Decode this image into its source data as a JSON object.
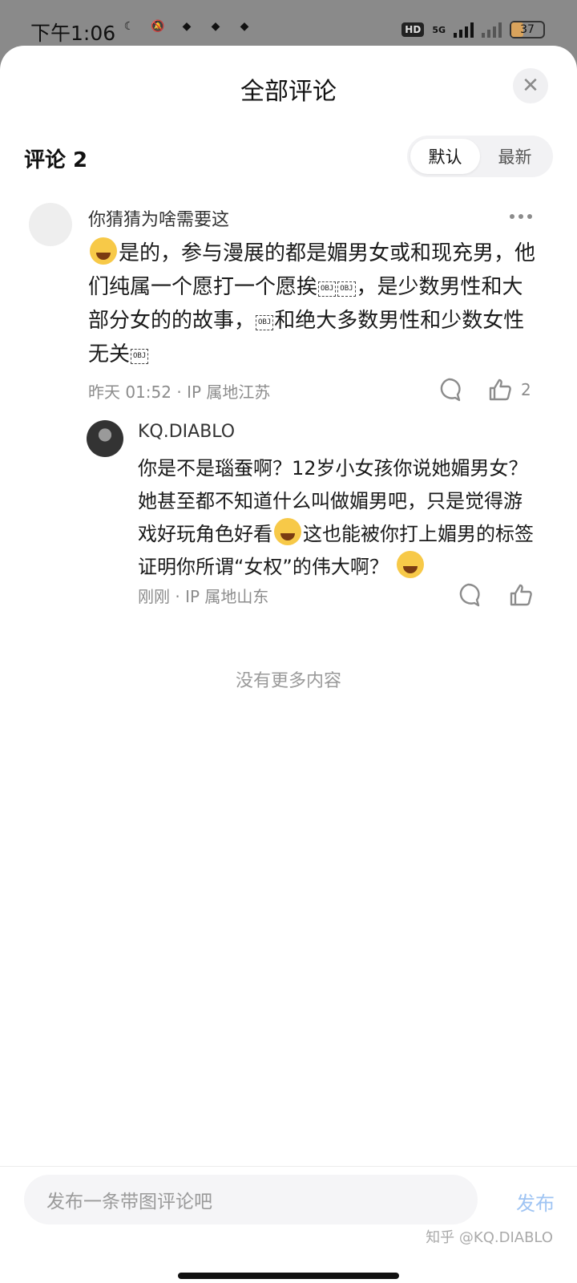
{
  "status_bar": {
    "time": "下午1:06",
    "hd": "HD",
    "net": "5G",
    "battery": "37"
  },
  "sheet": {
    "title": "全部评论",
    "close_icon": "✕",
    "count_label": "评论 2",
    "sort_default": "默认",
    "sort_latest": "最新"
  },
  "comments": [
    {
      "author": "你猜猜为啥需要这",
      "text_part1": "是的，参与漫展的都是媚男女或和现充男，他们纯属一个愿打一个愿挨",
      "text_part2": "，是少数男性和大部分女的的故事，",
      "text_part3": "和绝大多数男性和少数女性无关",
      "obj_marker": "OBJ",
      "time_location": "昨天 01:52 · IP 属地江苏",
      "likes": "2",
      "replies": [
        {
          "author": "KQ.DIABLO",
          "text_part1": "你是不是瑙蚕啊？12岁小女孩你说她媚男女？她甚至都不知道什么叫做媚男吧，只是觉得游戏好玩角色好看",
          "text_part2": "这也能被你打上媚男的标签证明你所谓“女权”的伟大啊？",
          "time_location": "刚刚 · IP 属地山东"
        }
      ]
    }
  ],
  "no_more": "没有更多内容",
  "composer": {
    "placeholder": "发布一条带图评论吧",
    "publish": "发布"
  },
  "watermark": "知乎 @KQ.DIABLO"
}
